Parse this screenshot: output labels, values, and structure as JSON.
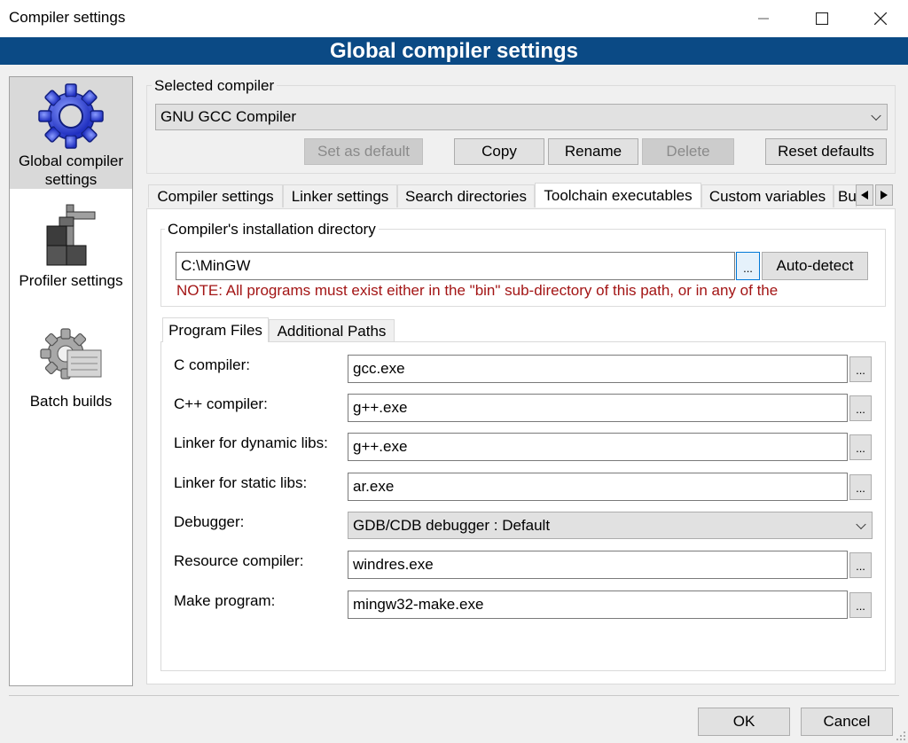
{
  "window": {
    "title": "Compiler settings",
    "minimize_icon": "minimize-icon",
    "maximize_icon": "maximize-icon",
    "close_icon": "close-icon"
  },
  "banner": {
    "title": "Global compiler settings"
  },
  "sidebar": {
    "items": [
      {
        "label": "Global compiler settings",
        "icon": "gear-icon",
        "selected": true
      },
      {
        "label": "Profiler settings",
        "icon": "caliper-icon",
        "selected": false
      },
      {
        "label": "Batch builds",
        "icon": "batch-gear-icon",
        "selected": false
      }
    ]
  },
  "compiler": {
    "group_label": "Selected compiler",
    "selected": "GNU GCC Compiler",
    "buttons": {
      "set_default": "Set as default",
      "copy": "Copy",
      "rename": "Rename",
      "delete": "Delete",
      "reset": "Reset defaults"
    }
  },
  "tabs": [
    "Compiler settings",
    "Linker settings",
    "Search directories",
    "Toolchain executables",
    "Custom variables",
    "Bu"
  ],
  "active_tab": "Toolchain executables",
  "install_dir": {
    "group_label": "Compiler's installation directory",
    "value": "C:\\MinGW",
    "browse": "...",
    "autodetect": "Auto-detect",
    "note": "NOTE: All programs must exist either in the \"bin\" sub-directory of this path, or in any of the"
  },
  "subtabs": [
    "Program Files",
    "Additional Paths"
  ],
  "programs": {
    "c_compiler": {
      "label": "C compiler:",
      "value": "gcc.exe"
    },
    "cpp_compiler": {
      "label": "C++ compiler:",
      "value": "g++.exe"
    },
    "linker_dynamic": {
      "label": "Linker for dynamic libs:",
      "value": "g++.exe"
    },
    "linker_static": {
      "label": "Linker for static libs:",
      "value": "ar.exe"
    },
    "debugger": {
      "label": "Debugger:",
      "value": "GDB/CDB debugger : Default"
    },
    "resource_compiler": {
      "label": "Resource compiler:",
      "value": "windres.exe"
    },
    "make": {
      "label": "Make program:",
      "value": "mingw32-make.exe"
    },
    "browse": "..."
  },
  "footer": {
    "ok": "OK",
    "cancel": "Cancel"
  },
  "colors": {
    "banner": "#0b4a85",
    "note": "#a31515",
    "focus": "#0078d7"
  }
}
